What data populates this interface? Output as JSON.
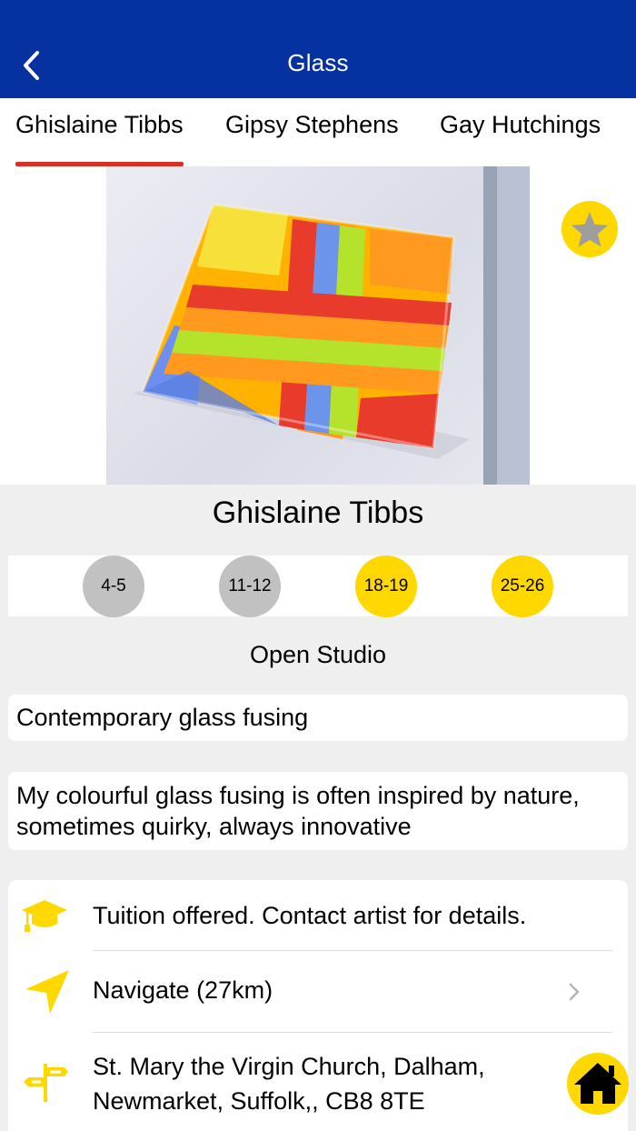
{
  "nav": {
    "title": "Glass",
    "back_icon": "chevron-left-icon"
  },
  "tabs": [
    {
      "label": "Ghislaine Tibbs",
      "active": true
    },
    {
      "label": "Gipsy Stephens",
      "active": false
    },
    {
      "label": "Gay Hutchings",
      "active": false
    }
  ],
  "favorite": {
    "icon": "star-icon"
  },
  "artist": {
    "name": "Ghislaine Tibbs",
    "dates": [
      {
        "label": "4-5",
        "status": "grey"
      },
      {
        "label": "11-12",
        "status": "grey"
      },
      {
        "label": "18-19",
        "status": "yellow"
      },
      {
        "label": "25-26",
        "status": "yellow"
      }
    ],
    "type": "Open Studio",
    "medium": "Contemporary glass fusing",
    "description": "My colourful glass fusing is often inspired by nature, sometimes quirky, always innovative"
  },
  "info": {
    "tuition": {
      "icon": "graduation-cap-icon",
      "text": "Tuition offered. Contact artist for details."
    },
    "navigate": {
      "icon": "location-arrow-icon",
      "text": "Navigate (27km)",
      "chevron": "chevron-right-icon"
    },
    "address": {
      "icon": "signpost-icon",
      "text": "St. Mary the Virgin Church, Dalham, Newmarket, Suffolk,, CB8 8TE"
    }
  },
  "home": {
    "icon": "home-icon"
  },
  "colors": {
    "nav_bg": "#0631a0",
    "tab_underline": "#d93025",
    "accent_yellow": "#ffd800",
    "inactive_grey": "#c1c1c1"
  }
}
